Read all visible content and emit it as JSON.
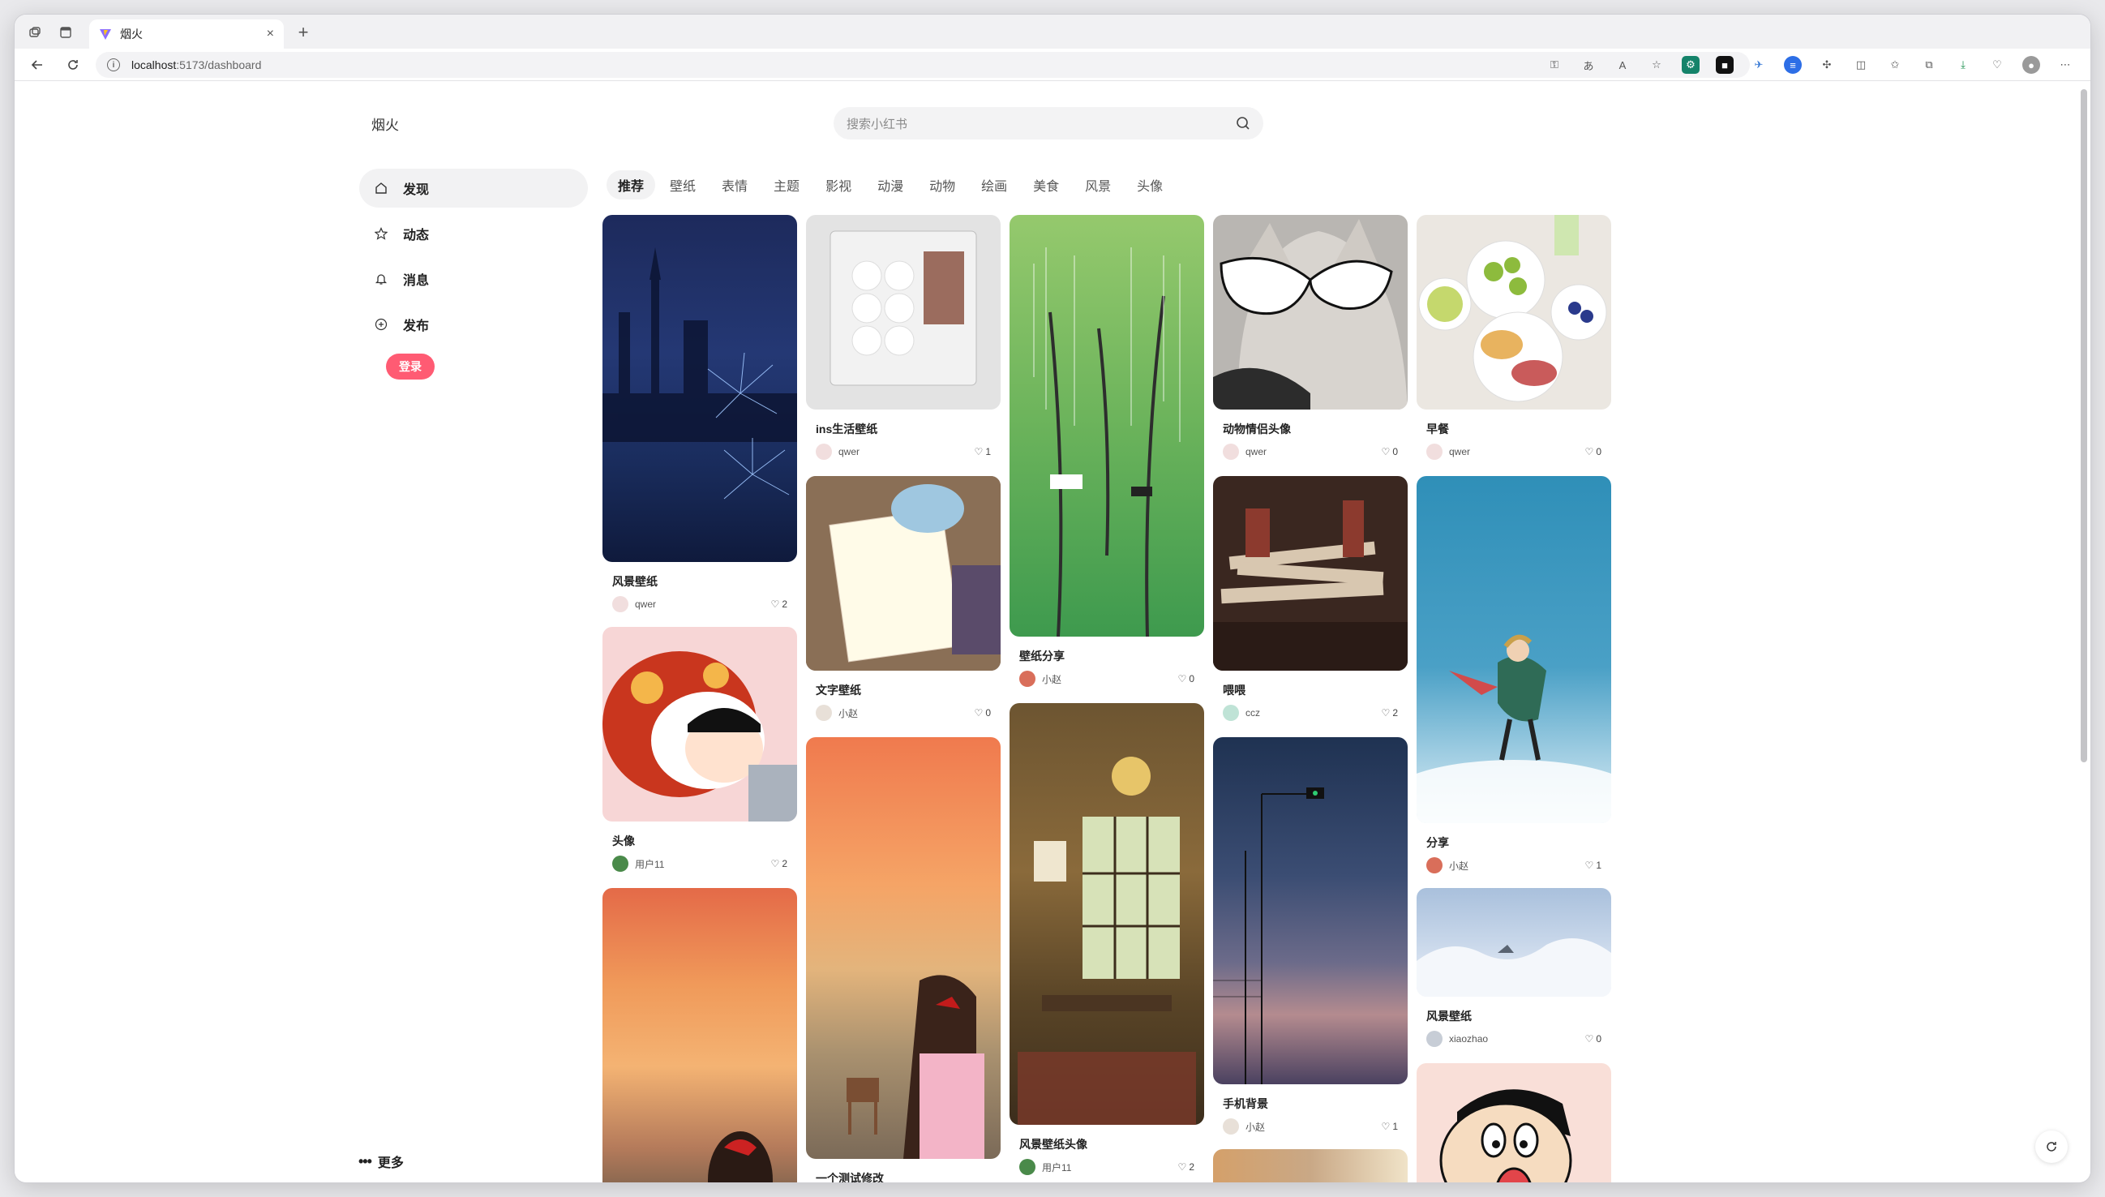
{
  "browser": {
    "tab_title": "烟火",
    "url_host": "localhost",
    "url_rest": ":5173/dashboard"
  },
  "app": {
    "logo": "烟火",
    "search_placeholder": "搜索小红书",
    "sidebar": [
      {
        "label": "发现",
        "icon": "home-icon",
        "active": true
      },
      {
        "label": "动态",
        "icon": "star-icon",
        "active": false
      },
      {
        "label": "消息",
        "icon": "bell-icon",
        "active": false
      },
      {
        "label": "发布",
        "icon": "plus-circle-icon",
        "active": false
      }
    ],
    "login_label": "登录",
    "more_label": "更多",
    "channels": [
      "推荐",
      "壁纸",
      "表情",
      "主题",
      "影视",
      "动漫",
      "动物",
      "绘画",
      "美食",
      "风景",
      "头像"
    ],
    "active_channel": "推荐"
  },
  "feed": [
    {
      "caption": "风景壁纸",
      "user": "qwer",
      "likes": "2"
    },
    {
      "caption": "头像",
      "user": "用户11",
      "likes": "2"
    },
    {
      "caption": "",
      "user": "",
      "likes": ""
    },
    {
      "caption": "ins生活壁纸",
      "user": "qwer",
      "likes": "1"
    },
    {
      "caption": "文字壁纸",
      "user": "小赵",
      "likes": "0"
    },
    {
      "caption": "一个测试修改",
      "user": "",
      "likes": ""
    },
    {
      "caption": "壁纸分享",
      "user": "小赵",
      "likes": "0"
    },
    {
      "caption": "风景壁纸头像",
      "user": "用户11",
      "likes": "2"
    },
    {
      "caption": "动物情侣头像",
      "user": "qwer",
      "likes": "0"
    },
    {
      "caption": "喂喂",
      "user": "ccz",
      "likes": "2"
    },
    {
      "caption": "手机背景",
      "user": "小赵",
      "likes": "1"
    },
    {
      "caption": "早餐",
      "user": "qwer",
      "likes": "0"
    },
    {
      "caption": "分享",
      "user": "小赵",
      "likes": "1"
    },
    {
      "caption": "风景壁纸",
      "user": "xiaozhao",
      "likes": "0"
    },
    {
      "caption": "",
      "user": "",
      "likes": ""
    }
  ]
}
